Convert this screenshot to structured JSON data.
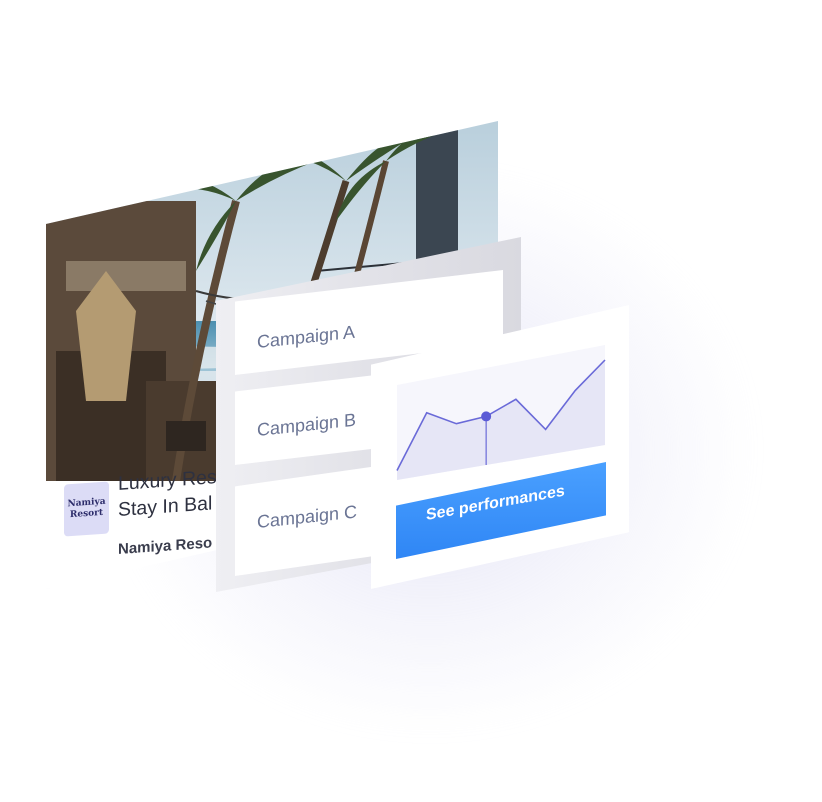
{
  "ad": {
    "logo_line1": "Namiya",
    "logo_line2": "Resort",
    "title_line1": "Luxury Res",
    "title_line2": "Stay In Bal",
    "brand_name": "Namiya Reso"
  },
  "campaigns": [
    {
      "label": "Campaign A"
    },
    {
      "label": "Campaign B"
    },
    {
      "label": "Campaign C"
    }
  ],
  "performance": {
    "button_label": "See performances",
    "accent_color": "#2f86f5",
    "line_color": "#6a6ad8"
  },
  "chart_data": {
    "type": "area",
    "x": [
      0,
      1,
      2,
      3,
      4,
      5,
      6,
      7
    ],
    "series": [
      {
        "values": [
          1,
          6.5,
          4.8,
          5.0,
          6.2,
          2.6,
          6.0,
          8.5
        ]
      }
    ],
    "highlight_index": 3,
    "ylim": [
      0,
      10
    ],
    "grid": false
  }
}
